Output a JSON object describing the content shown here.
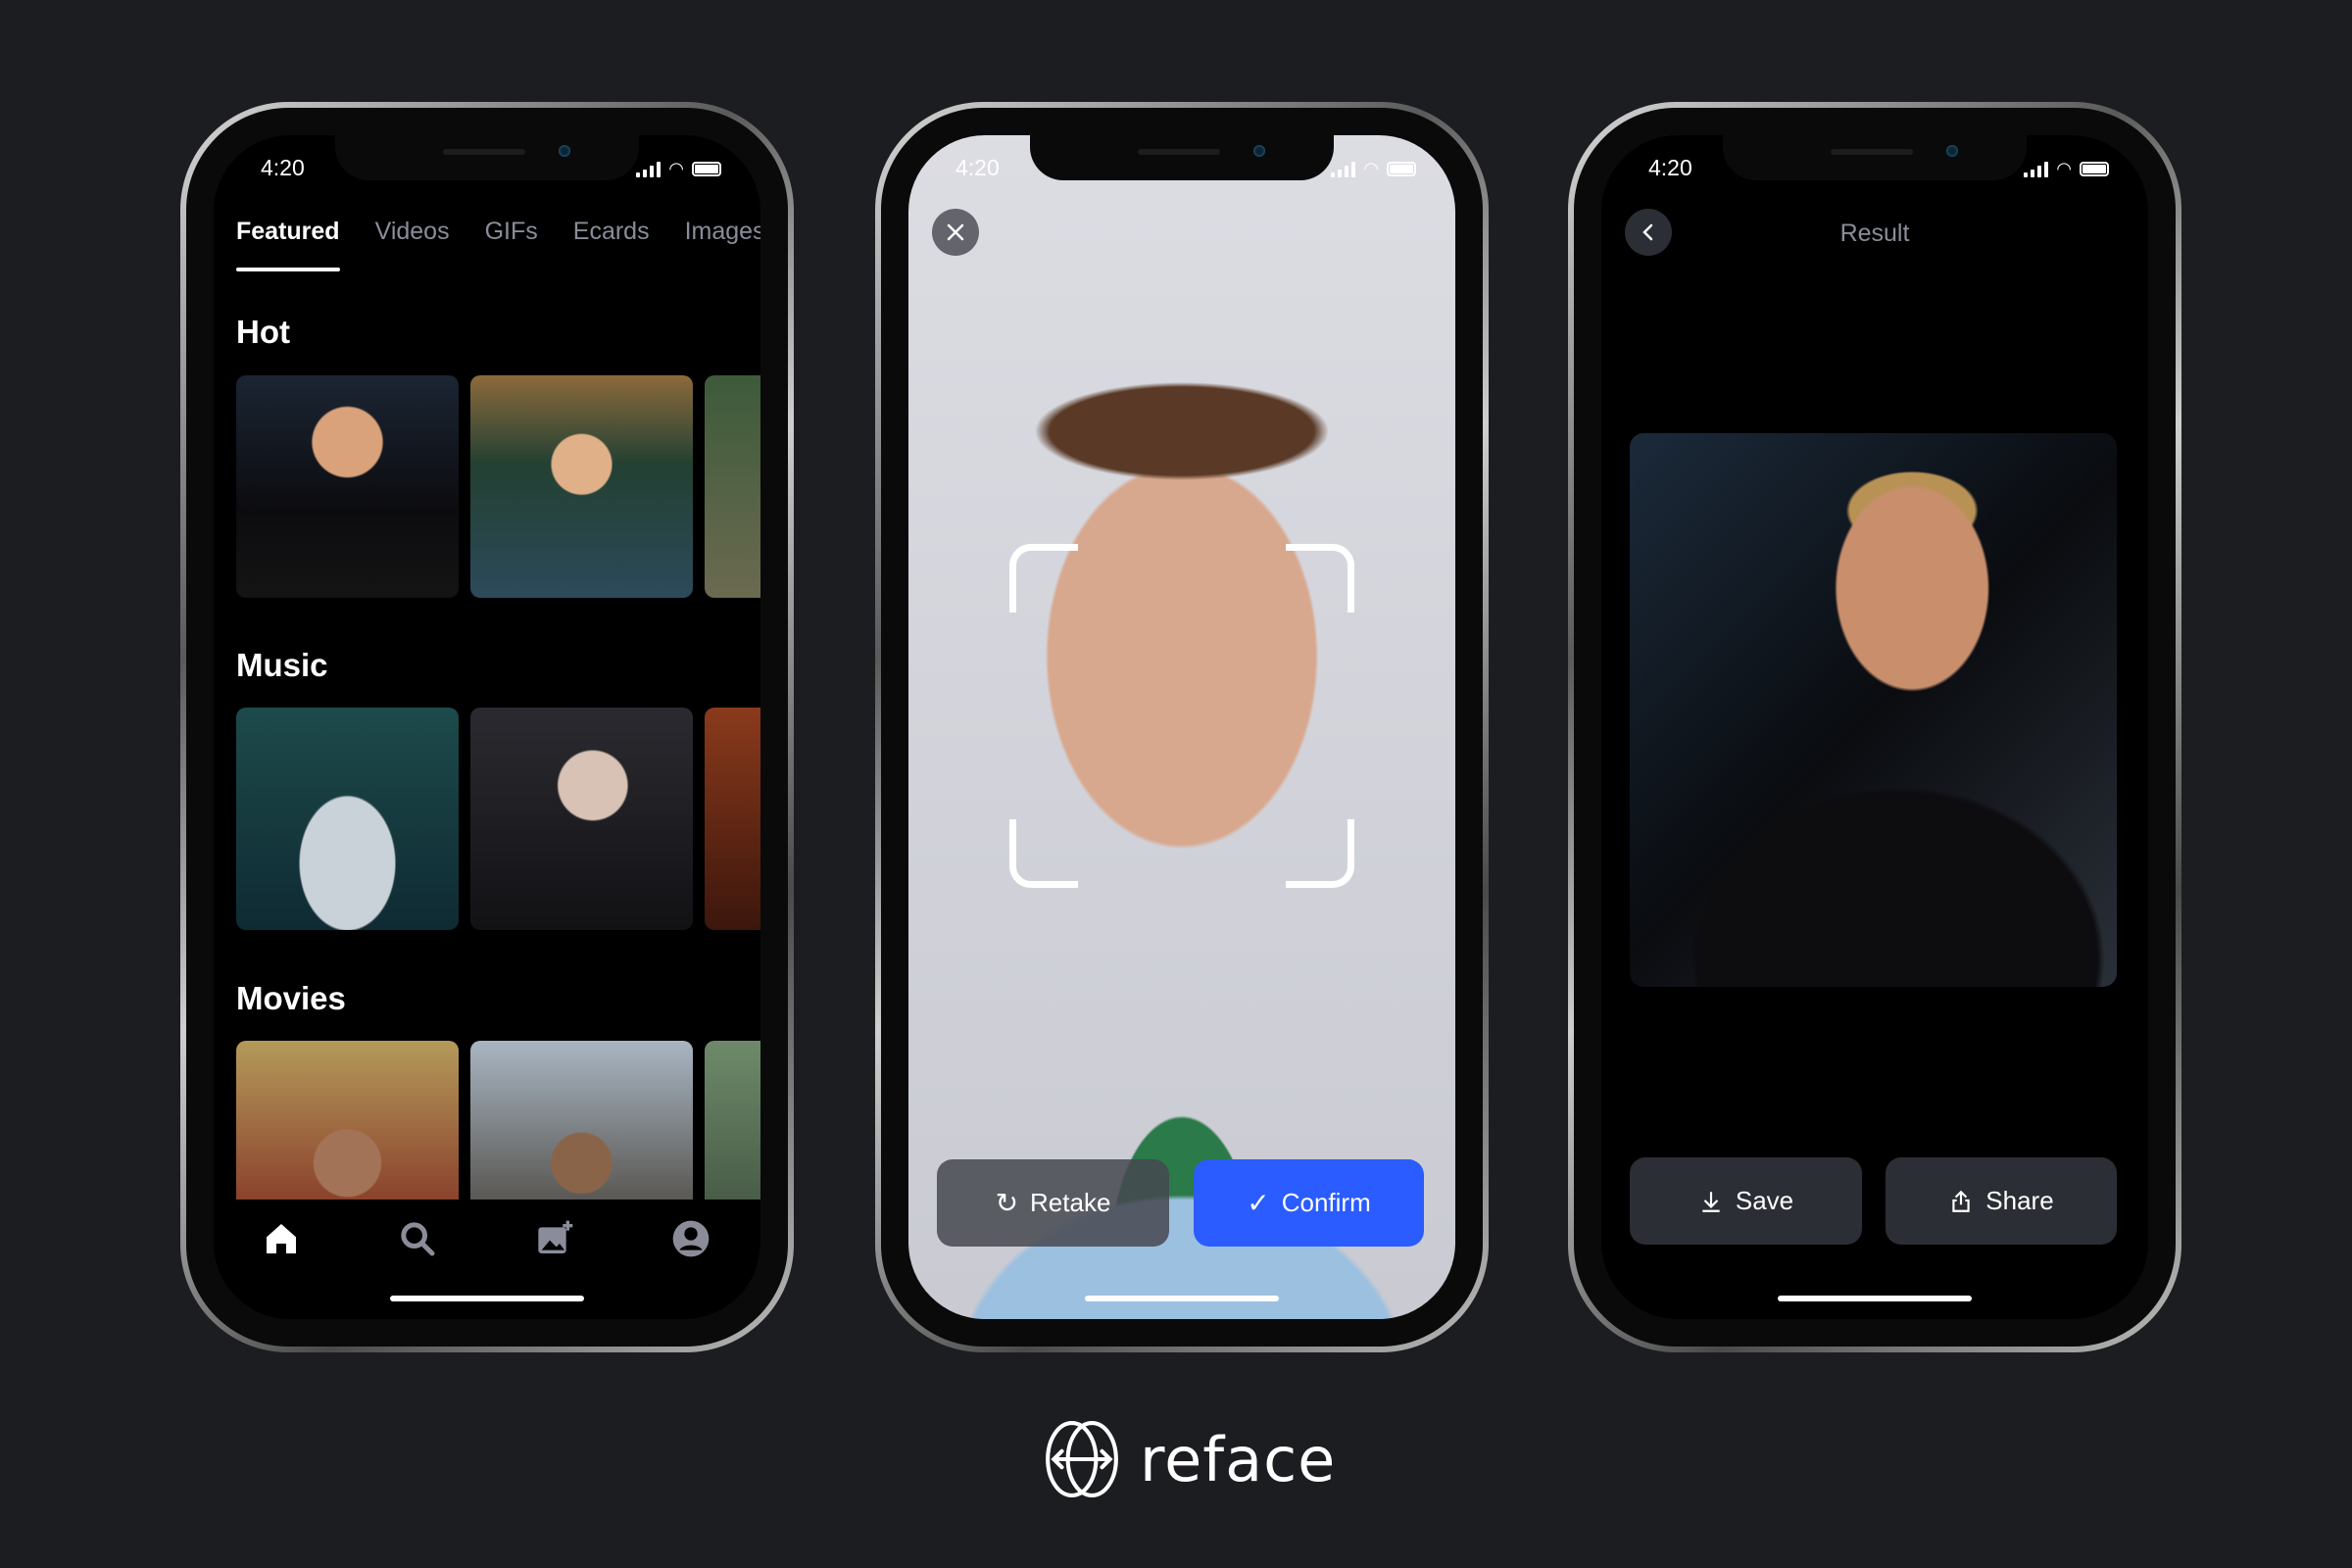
{
  "status_bar": {
    "time": "4:20"
  },
  "feed_screen": {
    "tabs": [
      {
        "label": "Featured",
        "active": true
      },
      {
        "label": "Videos",
        "active": false
      },
      {
        "label": "GIFs",
        "active": false
      },
      {
        "label": "Ecards",
        "active": false
      },
      {
        "label": "Images",
        "active": false
      }
    ],
    "sections": [
      {
        "title": "Hot"
      },
      {
        "title": "Music"
      },
      {
        "title": "Movies"
      }
    ],
    "bottom_nav": [
      {
        "icon": "home-icon",
        "active": true
      },
      {
        "icon": "search-icon",
        "active": false
      },
      {
        "icon": "add-image-icon",
        "active": false
      },
      {
        "icon": "profile-icon",
        "active": false
      }
    ]
  },
  "capture_screen": {
    "close_icon": "close-icon",
    "retake_label": "Retake",
    "confirm_label": "Confirm"
  },
  "result_screen": {
    "title": "Result",
    "back_icon": "chevron-left-icon",
    "save_label": "Save",
    "share_label": "Share"
  },
  "brand": {
    "name": "reface"
  },
  "colors": {
    "background": "#1c1d21",
    "accent": "#2a5cff",
    "button_dark": "#2c2e35"
  }
}
